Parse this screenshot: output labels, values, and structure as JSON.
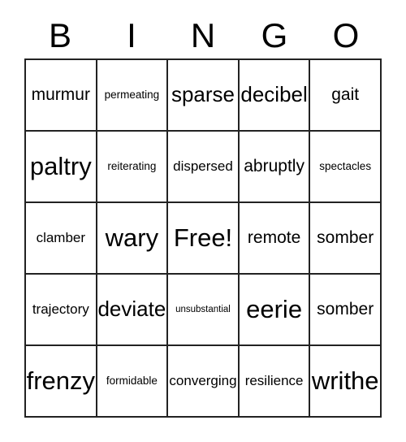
{
  "card": {
    "title": "BINGO",
    "header_letters": [
      "B",
      "I",
      "N",
      "G",
      "O"
    ],
    "free_space_label": "Free!",
    "grid_size": "5x5",
    "colors": {
      "background": "#ffffff",
      "text": "#000000",
      "border": "#222222"
    },
    "rows": [
      [
        {
          "text": "murmur",
          "size": "fs-lg"
        },
        {
          "text": "permeating",
          "size": "fs-sm"
        },
        {
          "text": "sparse",
          "size": "fs-xl"
        },
        {
          "text": "decibel",
          "size": "fs-xl"
        },
        {
          "text": "gait",
          "size": "fs-lg"
        }
      ],
      [
        {
          "text": "paltry",
          "size": "fs-xxl"
        },
        {
          "text": "reiterating",
          "size": "fs-sm"
        },
        {
          "text": "dispersed",
          "size": "fs-md"
        },
        {
          "text": "abruptly",
          "size": "fs-lg"
        },
        {
          "text": "spectacles",
          "size": "fs-sm"
        }
      ],
      [
        {
          "text": "clamber",
          "size": "fs-md"
        },
        {
          "text": "wary",
          "size": "fs-xxl"
        },
        {
          "text": "Free!",
          "size": "fs-xxl"
        },
        {
          "text": "remote",
          "size": "fs-lg"
        },
        {
          "text": "somber",
          "size": "fs-lg"
        }
      ],
      [
        {
          "text": "trajectory",
          "size": "fs-md"
        },
        {
          "text": "deviate",
          "size": "fs-xl"
        },
        {
          "text": "unsubstantial",
          "size": "fs-xs"
        },
        {
          "text": "eerie",
          "size": "fs-xxl"
        },
        {
          "text": "somber",
          "size": "fs-lg"
        }
      ],
      [
        {
          "text": "frenzy",
          "size": "fs-xxl"
        },
        {
          "text": "formidable",
          "size": "fs-sm"
        },
        {
          "text": "converging",
          "size": "fs-md"
        },
        {
          "text": "resilience",
          "size": "fs-md"
        },
        {
          "text": "writhe",
          "size": "fs-xxl"
        }
      ]
    ]
  }
}
